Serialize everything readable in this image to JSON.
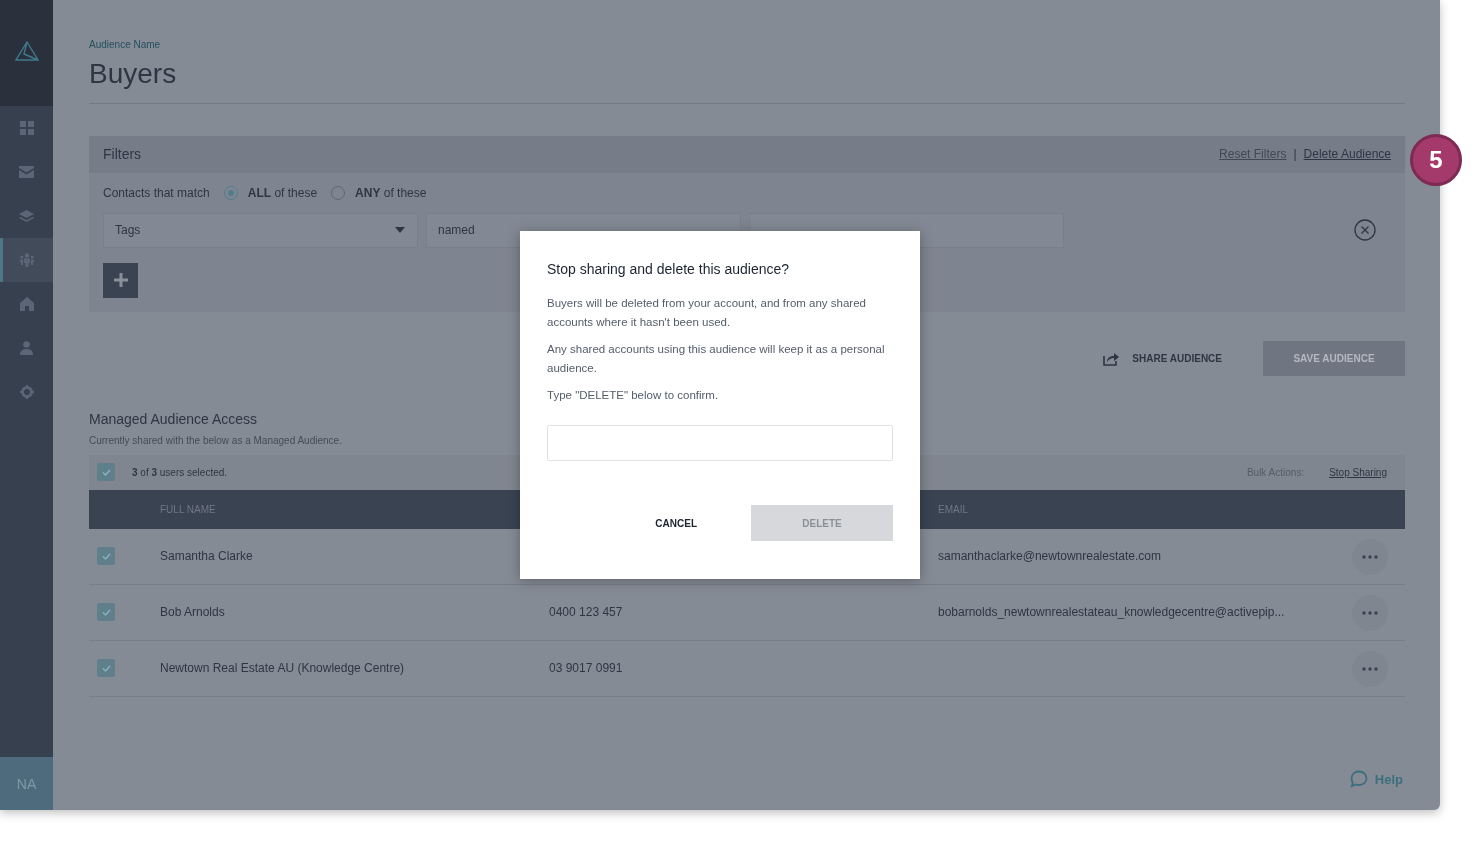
{
  "sidebar": {
    "items": [
      {
        "selected": false
      },
      {
        "selected": false
      },
      {
        "selected": false
      },
      {
        "selected": true
      },
      {
        "selected": false
      },
      {
        "selected": false
      },
      {
        "selected": false
      }
    ],
    "avatar": "NA"
  },
  "header": {
    "label": "Audience Name",
    "title": "Buyers"
  },
  "filters": {
    "title": "Filters",
    "link_separator": "|",
    "links": [
      {
        "label": "Reset Filters",
        "disabled": true
      },
      {
        "label": "Delete Audience",
        "disabled": false
      }
    ],
    "match_label": "Contacts that match",
    "match_options": [
      {
        "label": "**ALL** of these",
        "selected": true
      },
      {
        "label": "**ANY** of these",
        "selected": false
      }
    ],
    "rule": {
      "field": "Tags",
      "operator": "named"
    }
  },
  "actions": {
    "share": "SHARE AUDIENCE",
    "save": {
      "label": "SAVE AUDIENCE",
      "disabled": true
    }
  },
  "managed": {
    "title": "Managed Audience Access",
    "subtitle": "Currently shared with the below as a Managed Audience.",
    "all_checked": true,
    "selection": "**3** of **3** users selected.",
    "bulk_label": "Bulk Actions:",
    "bulk_link": "Stop Sharing",
    "columns": {
      "full_name": "FULL NAME",
      "email": "EMAIL"
    },
    "rows": [
      {
        "checked": true,
        "name": "Samantha Clarke",
        "email": "samanthaclarke@newtownrealestate.com"
      },
      {
        "checked": true,
        "name": "Bob Arnolds",
        "phone": "0400 123 457",
        "email": "bobarnolds_newtownrealestateau_knowledgecentre@activepip..."
      },
      {
        "checked": true,
        "name": "Newtown Real Estate AU (Knowledge Centre)",
        "phone": "03 9017 0991"
      }
    ]
  },
  "help": "Help",
  "dialog": {
    "title": "Stop sharing and delete this audience?",
    "paragraphs": [
      "Buyers will be deleted from your account, and from any shared accounts where it hasn't been used.",
      "Any shared accounts using this audience will keep it as a personal audience.",
      "Type \"DELETE\" below to confirm."
    ],
    "cancel": "CANCEL",
    "delete": {
      "label": "DELETE",
      "disabled": true
    }
  },
  "step_badge": "5"
}
